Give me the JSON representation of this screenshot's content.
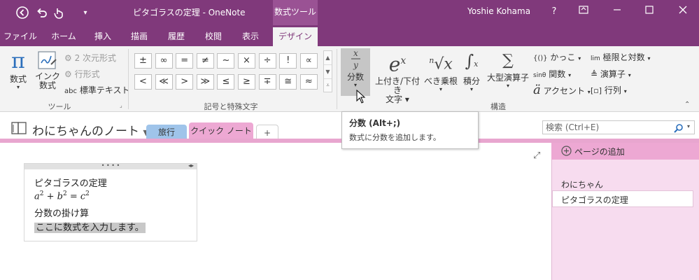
{
  "titlebar": {
    "title": "ピタゴラスの定理 - OneNote",
    "context_tab": "数式ツール",
    "user": "Yoshie Kohama",
    "help": "?",
    "back_icon": "back-icon",
    "undo_icon": "undo-icon",
    "touch_icon": "touch-icon",
    "dropdown_icon": "qat-dropdown-icon"
  },
  "tabs": [
    "ファイル",
    "ホーム",
    "挿入",
    "描画",
    "履歴",
    "校閲",
    "表示",
    "デザイン"
  ],
  "ribbon": {
    "tools": {
      "group_label": "ツール",
      "equation_label": "数式",
      "ink_label_1": "インク",
      "ink_label_2": "数式",
      "professional": "2 次元形式",
      "linear": "行形式",
      "normal_text_prefix": "abc",
      "normal_text": "標準テキスト"
    },
    "symbols": {
      "group_label": "記号と特殊文字",
      "row1": [
        "±",
        "∞",
        "=",
        "≠",
        "~",
        "×",
        "÷",
        "!",
        "∝"
      ],
      "row2": [
        "<",
        "≪",
        ">",
        "≫",
        "≤",
        "≥",
        "∓",
        "≅",
        "≈"
      ]
    },
    "structures": {
      "group_label": "構造",
      "fraction": "分数",
      "script": "上付き/下付き",
      "script_2": "文字",
      "radical": "べき乗根",
      "integral": "積分",
      "large_operator": "大型演算子",
      "bracket": "かっこ",
      "function": "関数",
      "accent": "アクセント",
      "limit_log": "極限と対数",
      "operator": "演算子",
      "matrix": "行列"
    }
  },
  "notebook": {
    "name": "わにちゃんのノート",
    "sections": [
      "旅行",
      "クイック ノート"
    ],
    "add_section": "+"
  },
  "search": {
    "placeholder": "検索 (Ctrl+E)"
  },
  "tooltip": {
    "title": "分数 (Alt+;)",
    "description": "数式に分数を追加します。"
  },
  "pages": {
    "add_page": "ページの追加",
    "group": "わにちゃん",
    "items": [
      "ピタゴラスの定理"
    ]
  },
  "note": {
    "line1": "ピタゴラスの定理",
    "line3": "分数の掛け算",
    "line4": "ここに数式を入力します。"
  }
}
